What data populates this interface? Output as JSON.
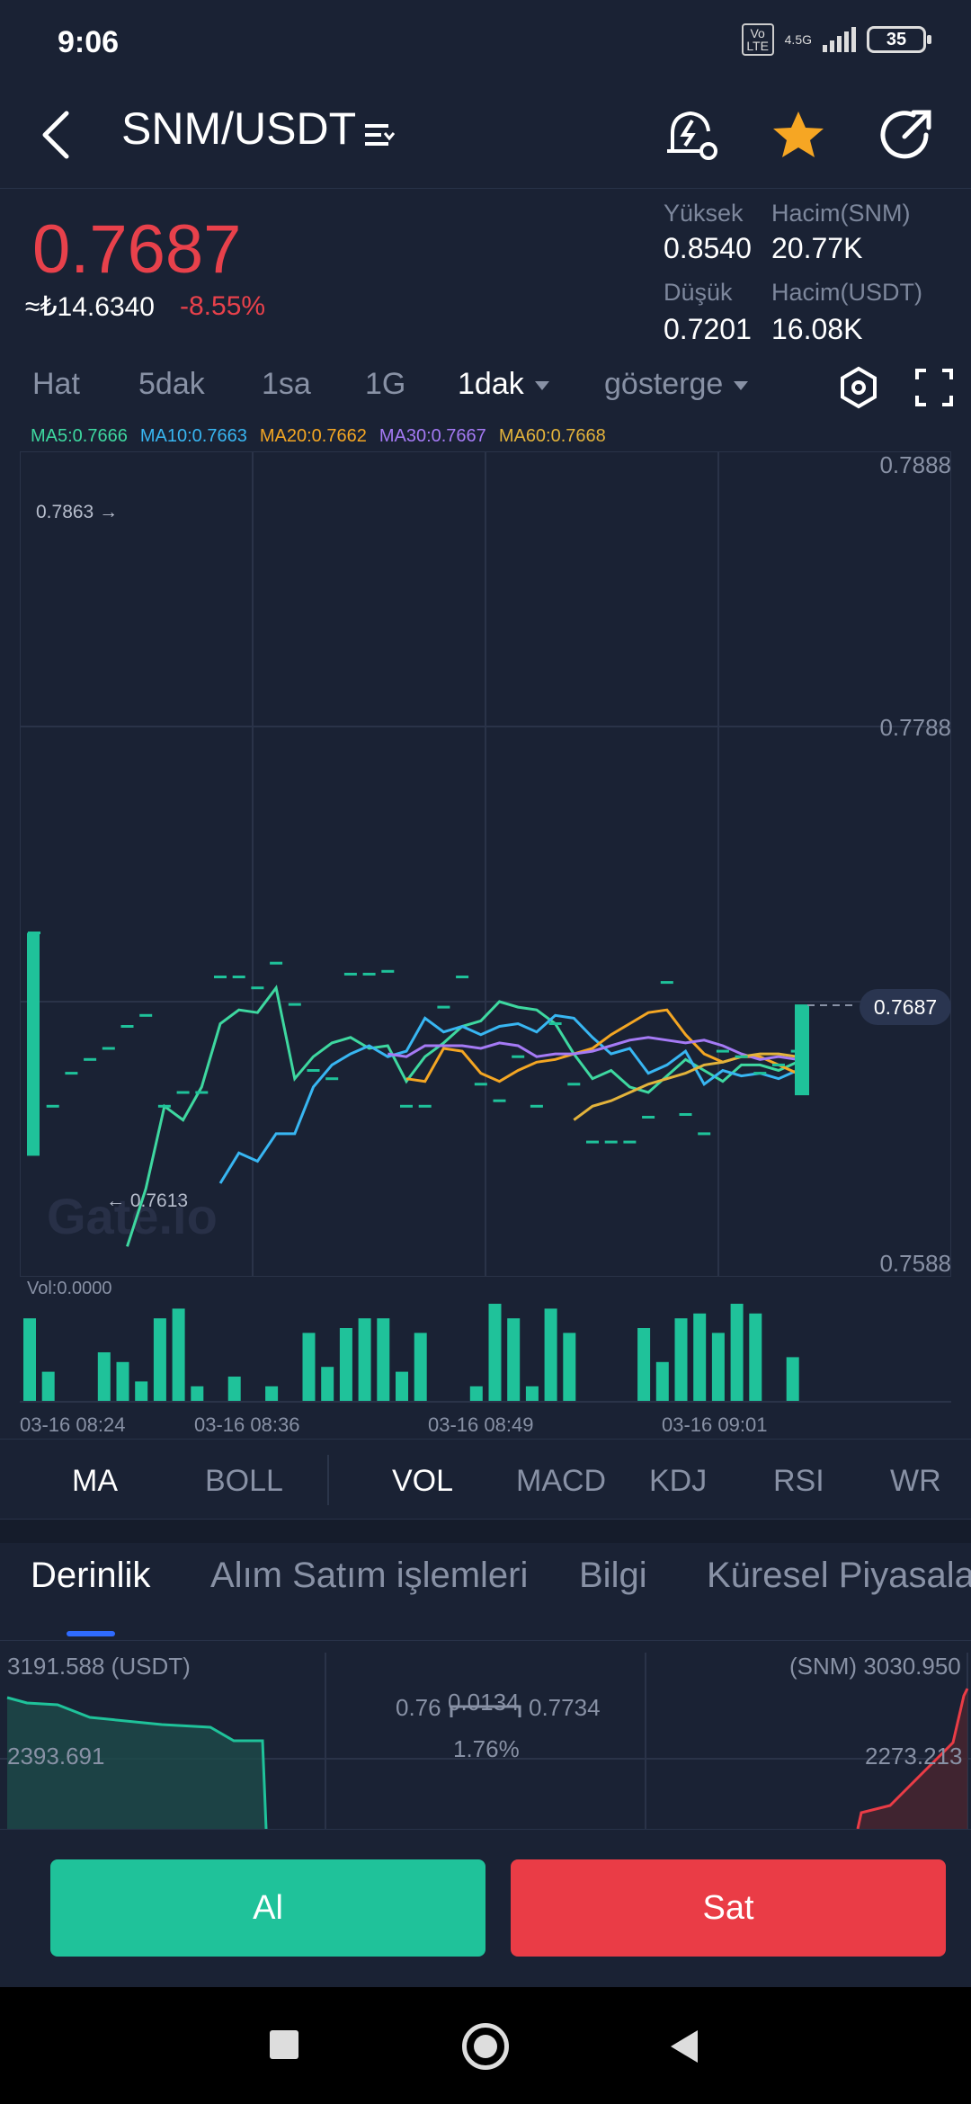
{
  "status": {
    "time": "9:06",
    "volte": "Vo LTE",
    "network": "4.5G",
    "battery": "35"
  },
  "header": {
    "pair": "SNM/USDT"
  },
  "ticker": {
    "price": "0.7687",
    "fiat": "≈₺14.6340",
    "change": "-8.55%",
    "high_label": "Yüksek",
    "high": "0.8540",
    "low_label": "Düşük",
    "low": "0.7201",
    "vol_base_label": "Hacim(SNM)",
    "vol_base": "20.77K",
    "vol_quote_label": "Hacim(USDT)",
    "vol_quote": "16.08K"
  },
  "timeframes": [
    "Hat",
    "5dak",
    "1sa",
    "1G",
    "1dak",
    "gösterge"
  ],
  "ma_legend": [
    {
      "text": "MA5:0.7666",
      "color": "#3ed8a0"
    },
    {
      "text": "MA10:0.7663",
      "color": "#38b6f2"
    },
    {
      "text": "MA20:0.7662",
      "color": "#f4a623"
    },
    {
      "text": "MA30:0.7667",
      "color": "#a57af5"
    },
    {
      "text": "MA60:0.7668",
      "color": "#e3b33b"
    }
  ],
  "chart_data": {
    "type": "candlestick",
    "y_ticks": [
      "0.7888",
      "0.7788",
      "0.7588"
    ],
    "last_price_tag": "0.7687",
    "max_marker": "0.7863 →",
    "min_marker": "← 0.7613",
    "watermark": "Gate.io",
    "volume_label": "Vol:0.0000",
    "x_ticks": [
      "03-16 08:24",
      "03-16 08:36",
      "03-16 08:49",
      "03-16 09:01"
    ],
    "ylim": [
      0.7588,
      0.7888
    ],
    "candles": [
      0.7713,
      0.765,
      0.7662,
      0.7667,
      0.7671,
      0.7679,
      0.7683,
      0.765,
      0.7655,
      0.7655,
      0.7697,
      0.7697,
      0.7693,
      0.7702,
      0.7687,
      0.7663,
      0.766,
      0.7698,
      0.7698,
      0.7699,
      0.765,
      0.765,
      0.7686,
      0.7697,
      0.7658,
      0.7652,
      0.7668,
      0.765,
      0.768,
      0.7658,
      0.7637,
      0.7637,
      0.7637,
      0.7646,
      0.7695,
      0.7647,
      0.764,
      0.767,
      0.7668,
      0.7662,
      0.7665,
      0.767
    ],
    "volume": [
      0.85,
      0.3,
      0.0,
      0.0,
      0.5,
      0.4,
      0.2,
      0.85,
      0.95,
      0.15,
      0.0,
      0.25,
      0.0,
      0.15,
      0.0,
      0.7,
      0.35,
      0.75,
      0.85,
      0.85,
      0.3,
      0.7,
      0.0,
      0.0,
      0.15,
      1.0,
      0.85,
      0.15,
      0.95,
      0.7,
      0.0,
      0.0,
      0.0,
      0.75,
      0.4,
      0.85,
      0.9,
      0.7,
      1.0,
      0.9,
      0.0,
      0.45
    ],
    "ma_series": [
      {
        "name": "MA5",
        "values": [
          0.7599,
          0.762,
          0.765,
          0.7645,
          0.7657,
          0.768,
          0.7685,
          0.7684,
          0.7693,
          0.766,
          0.7668,
          0.7673,
          0.7675,
          0.7671,
          0.7672,
          0.7659,
          0.7668,
          0.7673,
          0.7679,
          0.7681,
          0.7688,
          0.7686,
          0.7685,
          0.768,
          0.7669,
          0.766,
          0.7663,
          0.7657,
          0.7655,
          0.7661,
          0.7667,
          0.7663,
          0.7659,
          0.7665,
          0.7665,
          0.7663,
          0.7666
        ]
      },
      {
        "name": "MA10",
        "values": [
          0.7622,
          0.7633,
          0.763,
          0.764,
          0.764,
          0.7657,
          0.7665,
          0.7669,
          0.7672,
          0.7668,
          0.767,
          0.7682,
          0.7677,
          0.7679,
          0.7676,
          0.7679,
          0.768,
          0.7677,
          0.7683,
          0.7682,
          0.7675,
          0.7669,
          0.7671,
          0.7662,
          0.7665,
          0.767,
          0.7658,
          0.7663,
          0.7661,
          0.7662,
          0.766,
          0.7663
        ]
      },
      {
        "name": "MA20",
        "values": [
          0.766,
          0.7659,
          0.7671,
          0.767,
          0.7662,
          0.7659,
          0.7663,
          0.7666,
          0.7667,
          0.7669,
          0.7671,
          0.7676,
          0.768,
          0.7684,
          0.7685,
          0.7676,
          0.7669,
          0.7666,
          0.7668,
          0.7668,
          0.7665,
          0.7662
        ]
      },
      {
        "name": "MA30",
        "values": [
          0.7669,
          0.7668,
          0.7672,
          0.7672,
          0.7672,
          0.7671,
          0.7673,
          0.7672,
          0.7668,
          0.7669,
          0.7669,
          0.767,
          0.7672,
          0.7674,
          0.7675,
          0.7674,
          0.7673,
          0.7674,
          0.7672,
          0.7669,
          0.7667,
          0.7668,
          0.7667
        ]
      },
      {
        "name": "MA60",
        "values": [
          0.7645,
          0.765,
          0.7652,
          0.7655,
          0.7658,
          0.766,
          0.7662,
          0.7665,
          0.7666,
          0.7668,
          0.7669,
          0.7669,
          0.7668
        ]
      }
    ]
  },
  "indicators": [
    "MA",
    "BOLL",
    "VOL",
    "MACD",
    "KDJ",
    "RSI",
    "WR"
  ],
  "sections": [
    "Derinlik",
    "Alım Satım işlemleri",
    "Bilgi",
    "Küresel Piyasalar"
  ],
  "depth": {
    "left_top": "3191.588 (USDT)",
    "left_mid": "2393.691",
    "right_top": "(SNM) 3030.950",
    "right_mid": "2273.213",
    "bid": "0.76",
    "spread": "0.0134",
    "ask": "0.7734",
    "spread_pct": "1.76%"
  },
  "actions": {
    "buy": "Al",
    "sell": "Sat"
  },
  "colors": {
    "up": "#1fc29a",
    "down": "#ea3c46",
    "bg": "#1a2234",
    "accent": "#2f6bff"
  }
}
